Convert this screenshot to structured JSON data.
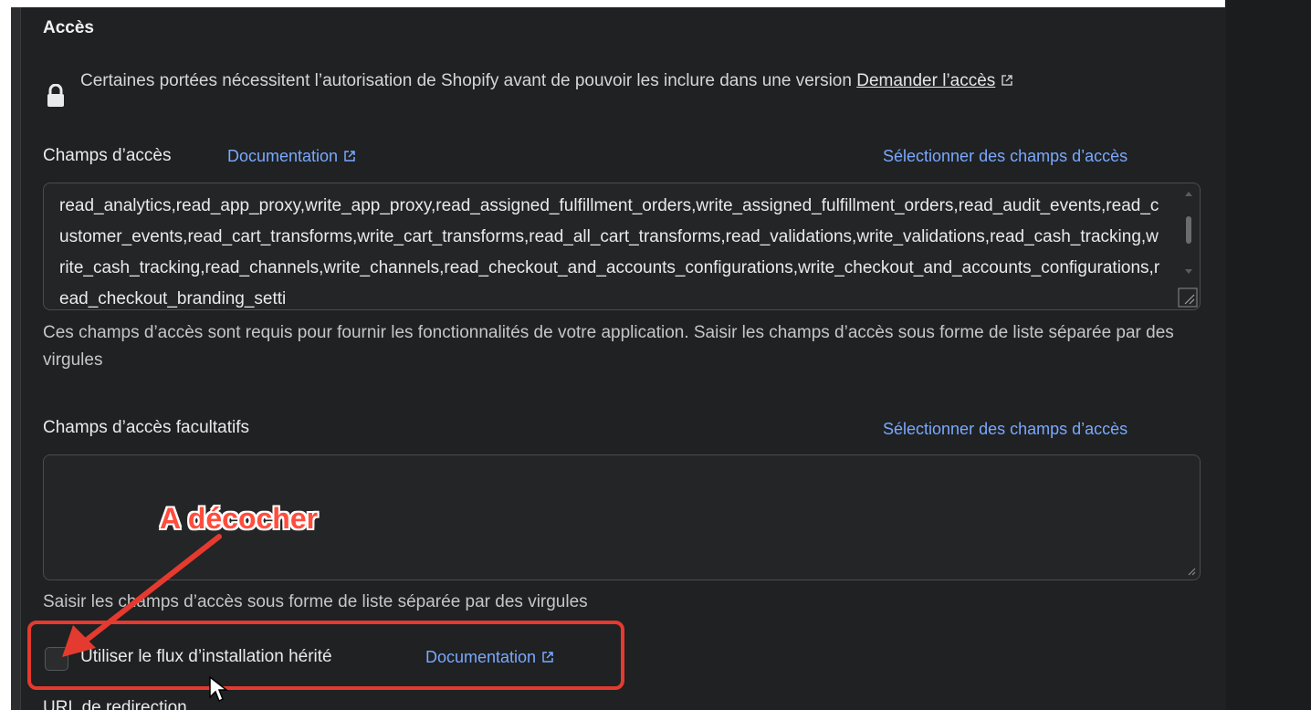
{
  "section": {
    "title": "Accès"
  },
  "notice": {
    "text": "Certaines portées nécessitent l’autorisation de Shopify avant de pouvoir les inclure dans une version ",
    "link_text": "Demander l’accès"
  },
  "access_scopes": {
    "label": "Champs d’accès",
    "doc_link": "Documentation",
    "select_link": "Sélectionner des champs d’accès",
    "value": "read_analytics,read_app_proxy,write_app_proxy,read_assigned_fulfillment_orders,write_assigned_fulfillment_orders,read_audit_events,read_customer_events,read_cart_transforms,write_cart_transforms,read_all_cart_transforms,read_validations,write_validations,read_cash_tracking,write_cash_tracking,read_channels,write_channels,read_checkout_and_accounts_configurations,write_checkout_and_accounts_configurations,read_checkout_branding_setti",
    "help": "Ces champs d’accès sont requis pour fournir les fonctionnalités de votre application. Saisir les champs d’accès sous forme de liste séparée par des virgules"
  },
  "optional_scopes": {
    "label": "Champs d’accès facultatifs",
    "select_link": "Sélectionner des champs d’accès",
    "value": "",
    "help": "Saisir les champs d’accès sous forme de liste séparée par des virgules"
  },
  "legacy_install": {
    "label": "Utiliser le flux d’installation hérité",
    "doc_link": "Documentation",
    "checked": false
  },
  "annotation": {
    "text": "A décocher",
    "color": "#e53a2f"
  },
  "next_section": {
    "title": "URL de redirection"
  },
  "colors": {
    "background": "#1f2122",
    "link_blue": "#7aa8ff",
    "annotation_red": "#e53a2f"
  }
}
